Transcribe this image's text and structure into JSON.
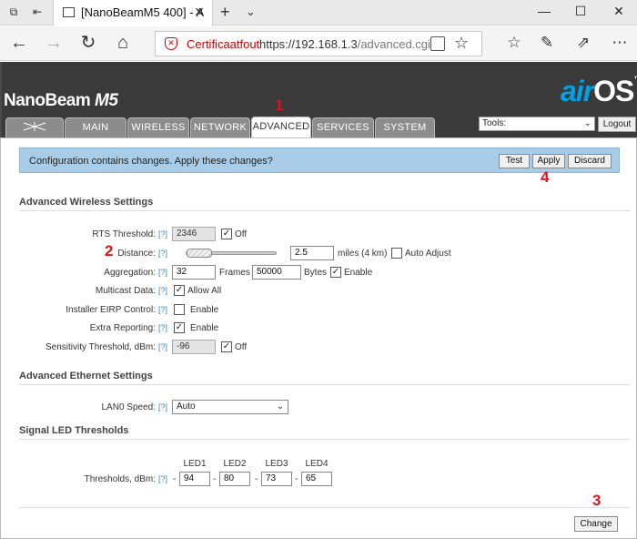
{
  "browser": {
    "tab_title": "[NanoBeamM5 400] - A",
    "cert_warning": "Certificaatfout",
    "url_host": "https://192.168.1.3",
    "url_path": "/advanced.cgi"
  },
  "device": {
    "brand": "NanoBeam",
    "model": "M5",
    "logo_air": "air",
    "logo_os": "OS",
    "logo_tm": "™"
  },
  "nav": {
    "tabs": [
      "MAIN",
      "WIRELESS",
      "NETWORK",
      "ADVANCED",
      "SERVICES",
      "SYSTEM"
    ],
    "active_tab": "ADVANCED",
    "tools_label": "Tools:",
    "logout_label": "Logout"
  },
  "banner": {
    "message": "Configuration contains changes. Apply these changes?",
    "test_label": "Test",
    "apply_label": "Apply",
    "discard_label": "Discard"
  },
  "wireless": {
    "title": "Advanced Wireless Settings",
    "help": "[?]",
    "rts_label": "RTS Threshold:",
    "rts_value": "2346",
    "rts_off_label": "Off",
    "rts_off_checked": true,
    "distance_label": "Distance:",
    "distance_value": "2.5",
    "distance_unit": "miles (4 km)",
    "auto_adjust_label": "Auto Adjust",
    "auto_adjust_checked": false,
    "aggregation_label": "Aggregation:",
    "aggregation_frames": "32",
    "frames_label": "Frames",
    "aggregation_bytes": "50000",
    "bytes_label": "Bytes",
    "aggregation_enable_label": "Enable",
    "aggregation_enable_checked": true,
    "multicast_label": "Multicast Data:",
    "multicast_allow_label": "Allow All",
    "multicast_checked": true,
    "eirp_label": "Installer EIRP Control:",
    "eirp_enable_label": "Enable",
    "eirp_checked": false,
    "extra_label": "Extra Reporting:",
    "extra_enable_label": "Enable",
    "extra_checked": true,
    "sensitivity_label": "Sensitivity Threshold, dBm:",
    "sensitivity_value": "-96",
    "sensitivity_off_label": "Off",
    "sensitivity_off_checked": true
  },
  "ethernet": {
    "title": "Advanced Ethernet Settings",
    "lan_label": "LAN0 Speed:",
    "lan_value": "Auto"
  },
  "led": {
    "title": "Signal LED Thresholds",
    "headers": [
      "LED1",
      "LED2",
      "LED3",
      "LED4"
    ],
    "thresholds_label": "Thresholds, dBm:",
    "values": [
      "94",
      "80",
      "73",
      "65"
    ],
    "dash": "-"
  },
  "footer": {
    "change_label": "Change"
  },
  "markers": [
    "1",
    "2",
    "3",
    "4"
  ],
  "colors": {
    "header_bg": "#3a3a3a",
    "accent_blue": "#00a2e5",
    "banner_bg": "#a9cde8",
    "marker_red": "#e1121a"
  }
}
